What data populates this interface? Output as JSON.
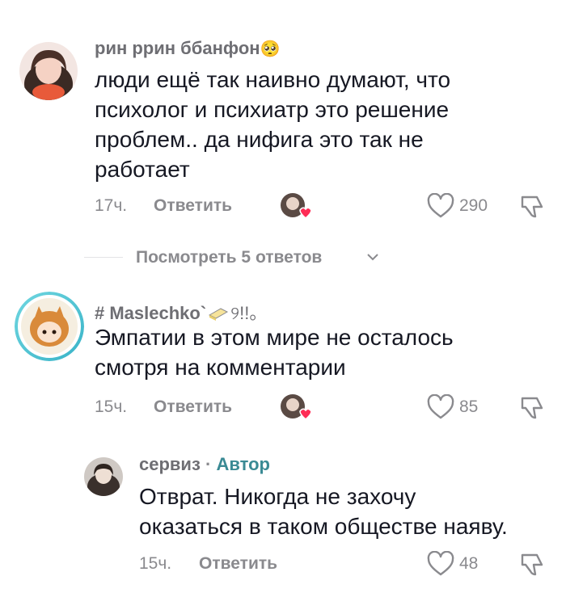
{
  "comments": [
    {
      "username": "рин ррин ббанфон",
      "username_emoji": "🥺",
      "text_lines": [
        "люди ещё так наивно думают, что",
        "психолог и психиатр это решение",
        "проблем.. да нифига это так не",
        "работает"
      ],
      "time": "17ч.",
      "reply_label": "Ответить",
      "likes": "290",
      "avatar_icon": "user-avatar-girl",
      "liked_by_icon": "creator-liked-heart-avatar"
    },
    {
      "username": "# Maslechko`",
      "username_suffix": "୨!!。",
      "text_lines": [
        "Эмпатии в этом мире не осталось",
        "смотря на комментарии"
      ],
      "time": "15ч.",
      "reply_label": "Ответить",
      "likes": "85",
      "avatar_icon": "anime-girl-avatar",
      "liked_by_icon": "creator-liked-heart-avatar"
    },
    {
      "username": "сервиз",
      "separator": "·",
      "badge": "Автор",
      "text_lines": [
        "Отврат. Никогда не захочу",
        "оказаться в таком обществе наяву."
      ],
      "time": "15ч.",
      "reply_label": "Ответить",
      "likes": "48",
      "avatar_icon": "author-avatar"
    }
  ],
  "view_replies": {
    "label": "Посмотреть 5 ответов",
    "icon": "chevron-down-icon"
  },
  "colors": {
    "text": "#161823",
    "muted": "#8a8a8e",
    "author_badge": "#3a8a94",
    "heart": "#fe2c55"
  }
}
